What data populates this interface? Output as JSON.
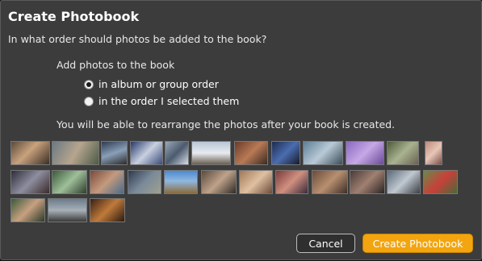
{
  "dialog": {
    "title": "Create Photobook",
    "question": "In what order should photos be added to the book?",
    "add_label": "Add photos to the book",
    "options": [
      {
        "label": "in album or group order",
        "selected": true
      },
      {
        "label": "in the order I selected them",
        "selected": false
      }
    ],
    "rearrange_note": "You will be able to rearrange the photos after your book is created.",
    "cancel_label": "Cancel",
    "create_label": "Create Photobook"
  },
  "photo_count": 32
}
